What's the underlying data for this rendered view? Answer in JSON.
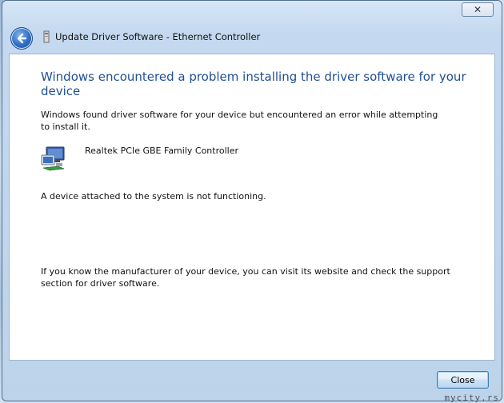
{
  "window": {
    "title": "Update Driver Software - Ethernet Controller",
    "close_glyph": "✕"
  },
  "content": {
    "headline": "Windows encountered a problem installing the driver software for your device",
    "intro": "Windows found driver software for your device but encountered an error while attempting to install it.",
    "device_name": "Realtek PCIe GBE Family Controller",
    "device_icon": "network-adapter-icon",
    "status": "A device attached to the system is not functioning.",
    "help": "If you know the manufacturer of your device, you can visit its website and check the support section for driver software."
  },
  "footer": {
    "close_label": "Close"
  },
  "watermark": "mycity.rs",
  "colors": {
    "headline": "#1f4f95",
    "window_frame": "#c4d9ef",
    "accent": "#2d6cc3"
  }
}
